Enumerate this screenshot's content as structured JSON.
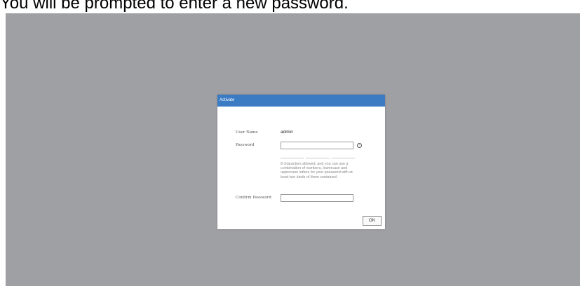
{
  "caption": "You will be prompted to enter a new password.",
  "dialog": {
    "title": "Activate",
    "user_name_label": "User Name",
    "user_name_value": "admin",
    "password_label": "Password",
    "password_value": "",
    "help_icon": "question-circle",
    "password_strength_segments": 3,
    "password_hint": "8 characters allowed, and you can use a combination of numbers, lowercase and uppercase letters for your password with at least two kinds of them contained.",
    "confirm_password_label": "Confirm Password",
    "confirm_password_value": "",
    "ok_label": "OK"
  },
  "colors": {
    "header": "#3a7bc4",
    "backdrop": "#9fa0a3"
  }
}
